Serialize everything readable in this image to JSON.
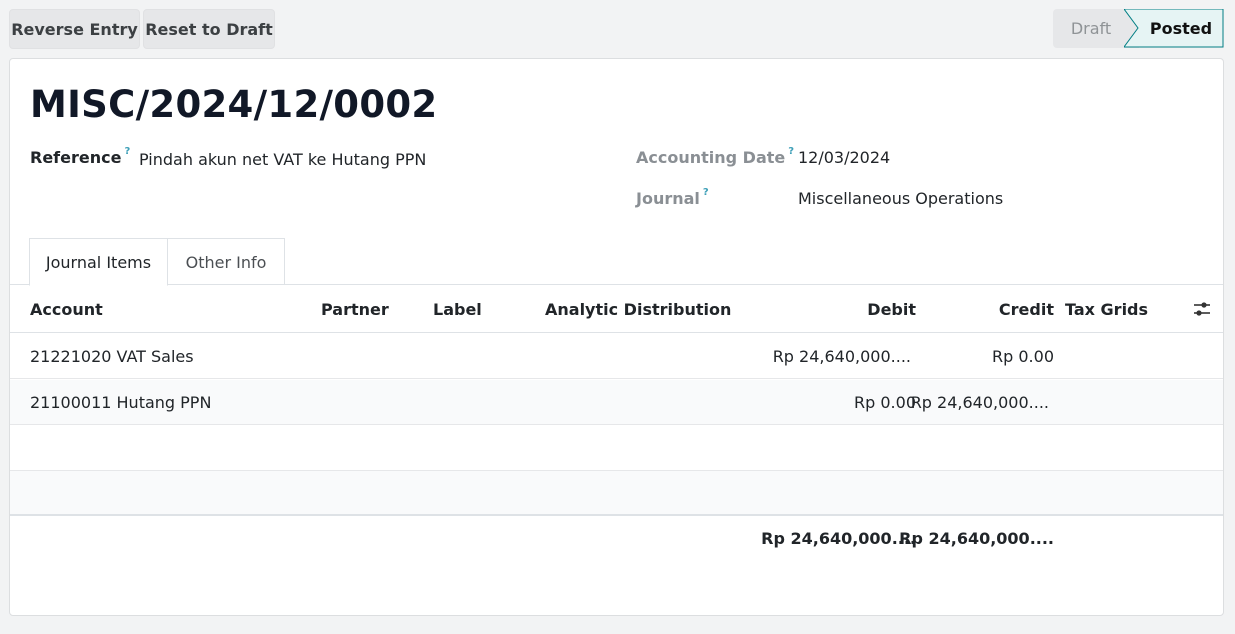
{
  "toolbar": {
    "reverse_label": "Reverse Entry",
    "reset_label": "Reset to Draft"
  },
  "status": {
    "steps": [
      "Draft",
      "Posted"
    ],
    "current": "Posted"
  },
  "entry": {
    "title": "MISC/2024/12/0002",
    "reference_label": "Reference",
    "reference_value": "Pindah akun net VAT ke Hutang PPN",
    "date_label": "Accounting Date",
    "date_value": "12/03/2024",
    "journal_label": "Journal",
    "journal_value": "Miscellaneous Operations",
    "help_mark": "?"
  },
  "tabs": [
    "Journal Items",
    "Other Info"
  ],
  "grid": {
    "columns": [
      "Account",
      "Partner",
      "Label",
      "Analytic Distribution",
      "Debit",
      "Credit",
      "Tax Grids"
    ],
    "rows": [
      {
        "account": "21221020 VAT Sales",
        "debit": "Rp 24,640,000....",
        "credit": "Rp 0.00"
      },
      {
        "account": "21100011 Hutang PPN",
        "debit": "Rp 0.00",
        "credit": "Rp 24,640,000...."
      }
    ],
    "totals": {
      "debit": "Rp 24,640,000....",
      "credit": "Rp 24,640,000...."
    }
  },
  "colors": {
    "accent": "#3fa0b8",
    "posted_bg": "#e6f4f4",
    "posted_border": "#017e84"
  },
  "icons": {
    "column_settings": "sliders-icon"
  }
}
